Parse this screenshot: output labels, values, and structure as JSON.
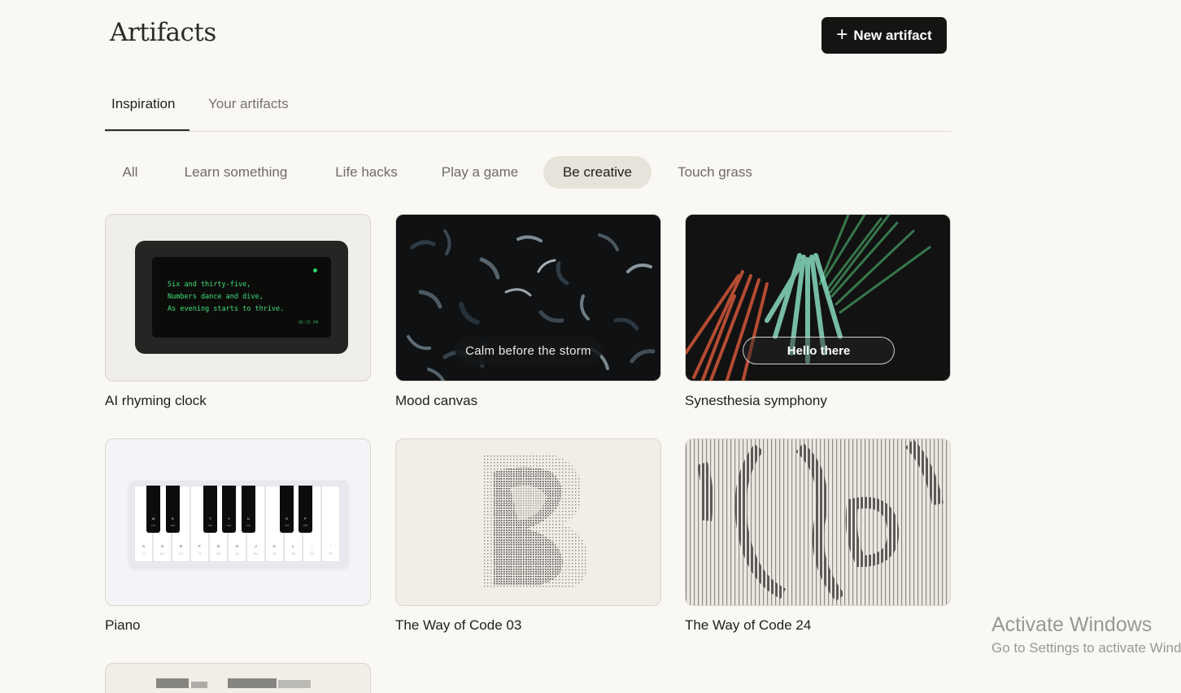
{
  "header": {
    "title": "Artifacts",
    "new_button_label": "New artifact"
  },
  "tabs": [
    {
      "label": "Inspiration",
      "active": true
    },
    {
      "label": "Your artifacts",
      "active": false
    }
  ],
  "filters": [
    {
      "label": "All",
      "active": false
    },
    {
      "label": "Learn something",
      "active": false
    },
    {
      "label": "Life hacks",
      "active": false
    },
    {
      "label": "Play a game",
      "active": false
    },
    {
      "label": "Be creative",
      "active": true
    },
    {
      "label": "Touch grass",
      "active": false
    }
  ],
  "cards": [
    {
      "title": "AI rhyming clock",
      "preview": {
        "poem": [
          "Six and thirty-five,",
          "Numbers dance and dive,",
          "As evening starts to thrive."
        ],
        "time": "06:35 PM"
      }
    },
    {
      "title": "Mood canvas",
      "preview": {
        "label": "Calm before the storm"
      }
    },
    {
      "title": "Synesthesia symphony",
      "preview": {
        "label": "Hello there"
      }
    },
    {
      "title": "Piano",
      "preview": {
        "white_keys": [
          {
            "key": "A",
            "note": "C4"
          },
          {
            "key": "S",
            "note": "D4"
          },
          {
            "key": "D",
            "note": "E4"
          },
          {
            "key": "F",
            "note": "F4"
          },
          {
            "key": "G",
            "note": "G4"
          },
          {
            "key": "H",
            "note": "A4"
          },
          {
            "key": "J",
            "note": "B4"
          },
          {
            "key": "K",
            "note": "C5"
          },
          {
            "key": "L",
            "note": "D5"
          },
          {
            "key": ";",
            "note": "E5"
          },
          {
            "key": "'",
            "note": "F5"
          }
        ],
        "black_keys": [
          {
            "key": "W",
            "note": "C#4"
          },
          {
            "key": "E",
            "note": "D#4"
          },
          {
            "key": "T",
            "note": "F#4"
          },
          {
            "key": "Y",
            "note": "G#4"
          },
          {
            "key": "U",
            "note": "A#4"
          },
          {
            "key": "O",
            "note": "C#5"
          },
          {
            "key": "P",
            "note": "D#5"
          }
        ]
      }
    },
    {
      "title": "The Way of Code 03"
    },
    {
      "title": "The Way of Code 24"
    }
  ],
  "watermark": {
    "line1": "Activate Windows",
    "line2": "Go to Settings to activate Windows."
  },
  "colors": {
    "background": "#f9f8f4",
    "primary_button": "#141413",
    "active_chip": "#e6e3da",
    "clock_text": "#3fe07a"
  }
}
